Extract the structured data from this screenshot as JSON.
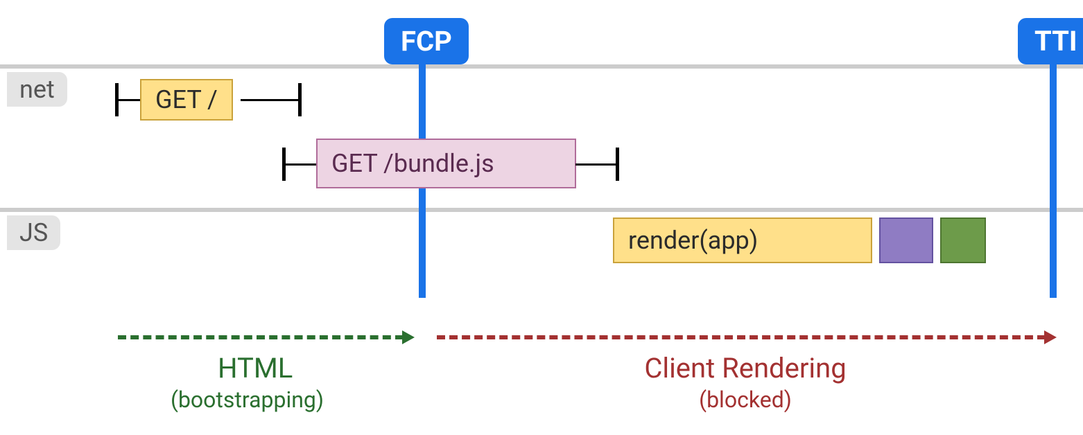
{
  "markers": {
    "fcp": "FCP",
    "tti": "TTI"
  },
  "lanes": {
    "net": "net",
    "js": "JS"
  },
  "blocks": {
    "get_root": "GET /",
    "get_bundle": "GET /bundle.js",
    "render_app": "render(app)"
  },
  "phases": {
    "html": {
      "title": "HTML",
      "subtitle": "(bootstrapping)"
    },
    "client": {
      "title": "Client Rendering",
      "subtitle": "(blocked)"
    }
  },
  "chart_data": {
    "type": "timeline",
    "description": "Client-side rendering lifecycle showing network and JS activity relative to FCP and TTI markers.",
    "time_axis_units": "relative",
    "markers": [
      {
        "name": "FCP",
        "position": 38
      },
      {
        "name": "TTI",
        "position": 97
      }
    ],
    "lanes": [
      {
        "name": "net",
        "items": [
          {
            "label": "GET /",
            "start": 10,
            "box_end": 22,
            "whisker_end": 28,
            "color": "yellow"
          },
          {
            "label": "GET /bundle.js",
            "start": 28,
            "box_end": 54,
            "whisker_end": 58,
            "color": "pink"
          }
        ]
      },
      {
        "name": "JS",
        "items": [
          {
            "label": "render(app)",
            "start": 58,
            "end": 82,
            "color": "yellow"
          },
          {
            "label": "",
            "start": 83,
            "end": 88,
            "color": "purple"
          },
          {
            "label": "",
            "start": 89,
            "end": 93,
            "color": "green"
          }
        ]
      }
    ],
    "phases": [
      {
        "name": "HTML",
        "note": "bootstrapping",
        "start": 10,
        "end": 38,
        "color": "green"
      },
      {
        "name": "Client Rendering",
        "note": "blocked",
        "start": 40,
        "end": 97,
        "color": "red"
      }
    ]
  }
}
